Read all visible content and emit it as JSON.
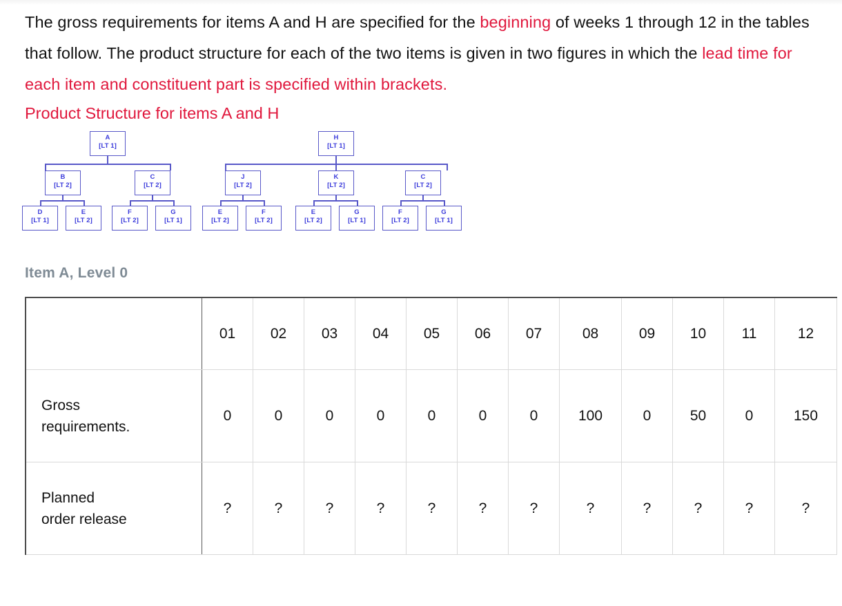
{
  "intro": {
    "seg1": "The gross requirements for items A and H are specified for the ",
    "seg_red1": "beginning",
    "seg2": " of weeks 1 through 12 in the tables that follow.   The product structure for each of the two items is given in two figures in which the ",
    "seg_red2": "lead time for each item and constituent part is specified within brackets.",
    "structure_title": "Product Structure for items A and H"
  },
  "colors": {
    "accent_red": "#e0173c",
    "node_border": "#5757c8",
    "node_text": "#3b3bdb",
    "heading_gray": "#7f8b95"
  },
  "trees": [
    {
      "name": "tree-item-a",
      "root": {
        "label": "A",
        "lead_time": "[LT 1]"
      },
      "level1": [
        {
          "label": "B",
          "lead_time": "[LT 2]"
        },
        {
          "label": "C",
          "lead_time": "[LT 2]"
        }
      ],
      "level2": [
        {
          "label": "D",
          "lead_time": "[LT 1]"
        },
        {
          "label": "E",
          "lead_time": "[LT 2]"
        },
        {
          "label": "F",
          "lead_time": "[LT 2]"
        },
        {
          "label": "G",
          "lead_time": "[LT 1]"
        }
      ]
    },
    {
      "name": "tree-item-h",
      "root": {
        "label": "H",
        "lead_time": "[LT 1]"
      },
      "level1": [
        {
          "label": "J",
          "lead_time": "[LT 2]"
        },
        {
          "label": "K",
          "lead_time": "[LT 2]"
        },
        {
          "label": "C",
          "lead_time": "[LT 2]"
        }
      ],
      "level2": [
        {
          "label": "E",
          "lead_time": "[LT 2]"
        },
        {
          "label": "F",
          "lead_time": "[LT 2]"
        },
        {
          "label": "E",
          "lead_time": "[LT 2]"
        },
        {
          "label": "G",
          "lead_time": "[LT 1]"
        },
        {
          "label": "F",
          "lead_time": "[LT 2]"
        },
        {
          "label": "G",
          "lead_time": "[LT 1]"
        }
      ]
    }
  ],
  "item_heading": "Item A, Level 0",
  "table": {
    "corner": "",
    "weeks": [
      "01",
      "02",
      "03",
      "04",
      "05",
      "06",
      "07",
      "08",
      "09",
      "10",
      "11",
      "12"
    ],
    "rows": [
      {
        "label_line1": "Gross",
        "label_line2": "requirements.",
        "values": [
          "0",
          "0",
          "0",
          "0",
          "0",
          "0",
          "0",
          "100",
          "0",
          "50",
          "0",
          "150"
        ]
      },
      {
        "label_line1": "Planned",
        "label_line2": "order release",
        "values": [
          "?",
          "?",
          "?",
          "?",
          "?",
          "?",
          "?",
          "?",
          "?",
          "?",
          "?",
          "?"
        ]
      }
    ]
  }
}
